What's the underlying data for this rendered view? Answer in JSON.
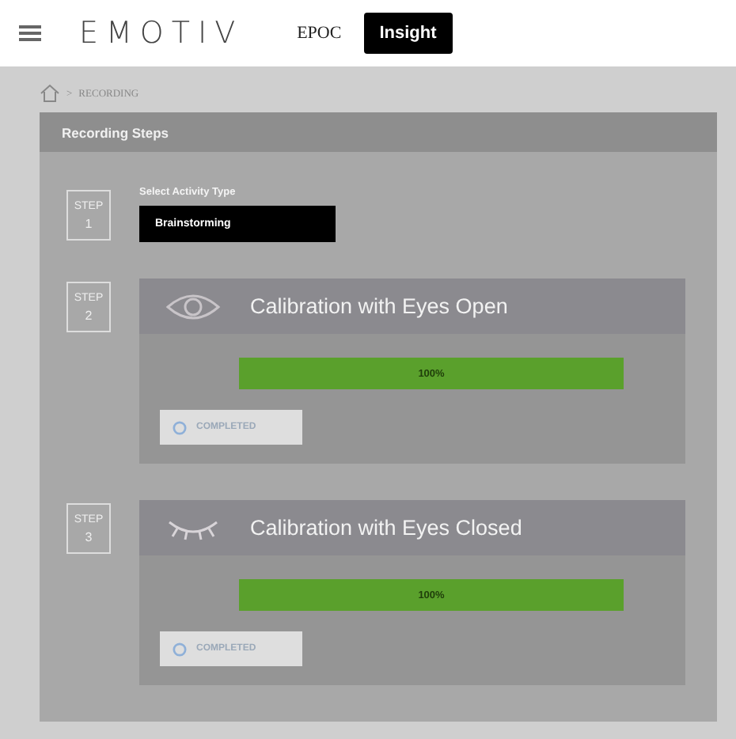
{
  "header": {
    "brand": "EMOTIV",
    "device_tabs": [
      {
        "label": "EPOC",
        "selected": false
      },
      {
        "label": "Insight",
        "selected": true
      }
    ]
  },
  "breadcrumb": {
    "separator": ">",
    "current": "RECORDING"
  },
  "panel": {
    "title": "Recording Steps",
    "steps": [
      {
        "kind": "select",
        "step_label": "STEP",
        "number": "1",
        "field_label": "Select Activity Type",
        "value": "Brainstorming"
      },
      {
        "kind": "eyesopen",
        "step_label": "STEP",
        "number": "2",
        "title": "Calibration with Eyes Open",
        "level": 1,
        "reading": "100%",
        "button": "COMPLETED"
      },
      {
        "kind": "eyesclosed",
        "step_label": "STEP",
        "number": "3",
        "title": "Calibration with Eyes Closed",
        "level": 1,
        "reading": "100%",
        "button": "COMPLETED"
      }
    ]
  }
}
